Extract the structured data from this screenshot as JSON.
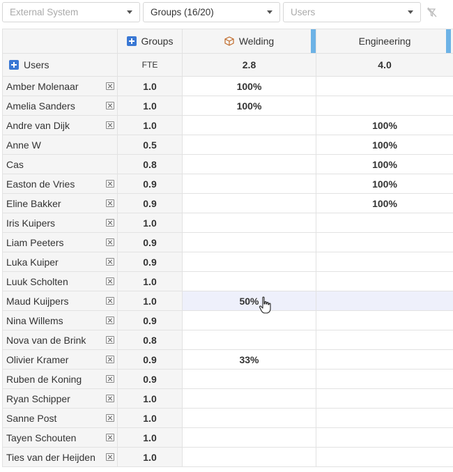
{
  "filters": {
    "external_system": "External System",
    "groups": "Groups (16/20)",
    "users": "Users"
  },
  "header": {
    "groups_label": "Groups",
    "users_label": "Users",
    "fte_label": "FTE",
    "columns": [
      {
        "name": "Welding",
        "total": "2.8"
      },
      {
        "name": "Engineering",
        "total": "4.0"
      }
    ]
  },
  "rows": [
    {
      "name": "Amber Molenaar",
      "fte": "1.0",
      "welding": "100%",
      "engineering": "",
      "removable": true
    },
    {
      "name": "Amelia Sanders",
      "fte": "1.0",
      "welding": "100%",
      "engineering": "",
      "removable": true
    },
    {
      "name": "Andre van Dijk",
      "fte": "1.0",
      "welding": "",
      "engineering": "100%",
      "removable": true
    },
    {
      "name": "Anne W",
      "fte": "0.5",
      "welding": "",
      "engineering": "100%",
      "removable": false
    },
    {
      "name": "Cas",
      "fte": "0.8",
      "welding": "",
      "engineering": "100%",
      "removable": false
    },
    {
      "name": "Easton de Vries",
      "fte": "0.9",
      "welding": "",
      "engineering": "100%",
      "removable": true
    },
    {
      "name": "Eline Bakker",
      "fte": "0.9",
      "welding": "",
      "engineering": "100%",
      "removable": true
    },
    {
      "name": "Iris Kuipers",
      "fte": "1.0",
      "welding": "",
      "engineering": "",
      "removable": true
    },
    {
      "name": "Liam Peeters",
      "fte": "0.9",
      "welding": "",
      "engineering": "",
      "removable": true
    },
    {
      "name": "Luka Kuiper",
      "fte": "0.9",
      "welding": "",
      "engineering": "",
      "removable": true
    },
    {
      "name": "Luuk Scholten",
      "fte": "1.0",
      "welding": "",
      "engineering": "",
      "removable": true
    },
    {
      "name": "Maud Kuijpers",
      "fte": "1.0",
      "welding": "50%",
      "engineering": "",
      "removable": true,
      "highlighted": true
    },
    {
      "name": "Nina Willems",
      "fte": "0.9",
      "welding": "",
      "engineering": "",
      "removable": true
    },
    {
      "name": "Nova van de Brink",
      "fte": "0.8",
      "welding": "",
      "engineering": "",
      "removable": true
    },
    {
      "name": "Olivier Kramer",
      "fte": "0.9",
      "welding": "33%",
      "engineering": "",
      "removable": true
    },
    {
      "name": "Ruben de Koning",
      "fte": "0.9",
      "welding": "",
      "engineering": "",
      "removable": true
    },
    {
      "name": "Ryan Schipper",
      "fte": "1.0",
      "welding": "",
      "engineering": "",
      "removable": true
    },
    {
      "name": "Sanne Post",
      "fte": "1.0",
      "welding": "",
      "engineering": "",
      "removable": true
    },
    {
      "name": "Tayen Schouten",
      "fte": "1.0",
      "welding": "",
      "engineering": "",
      "removable": true
    },
    {
      "name": "Ties van der Heijden",
      "fte": "1.0",
      "welding": "",
      "engineering": "",
      "removable": true
    }
  ],
  "colors": {
    "accent": "#3a78d4",
    "column_edge": "#6cb2e6",
    "highlight_row": "#eef0fb"
  },
  "icons": {
    "add": "plus-square-icon",
    "group": "box-icon",
    "remove": "remove-x-icon",
    "clear_filter": "filter-clear-icon",
    "cursor": "hand-pointer-icon"
  }
}
